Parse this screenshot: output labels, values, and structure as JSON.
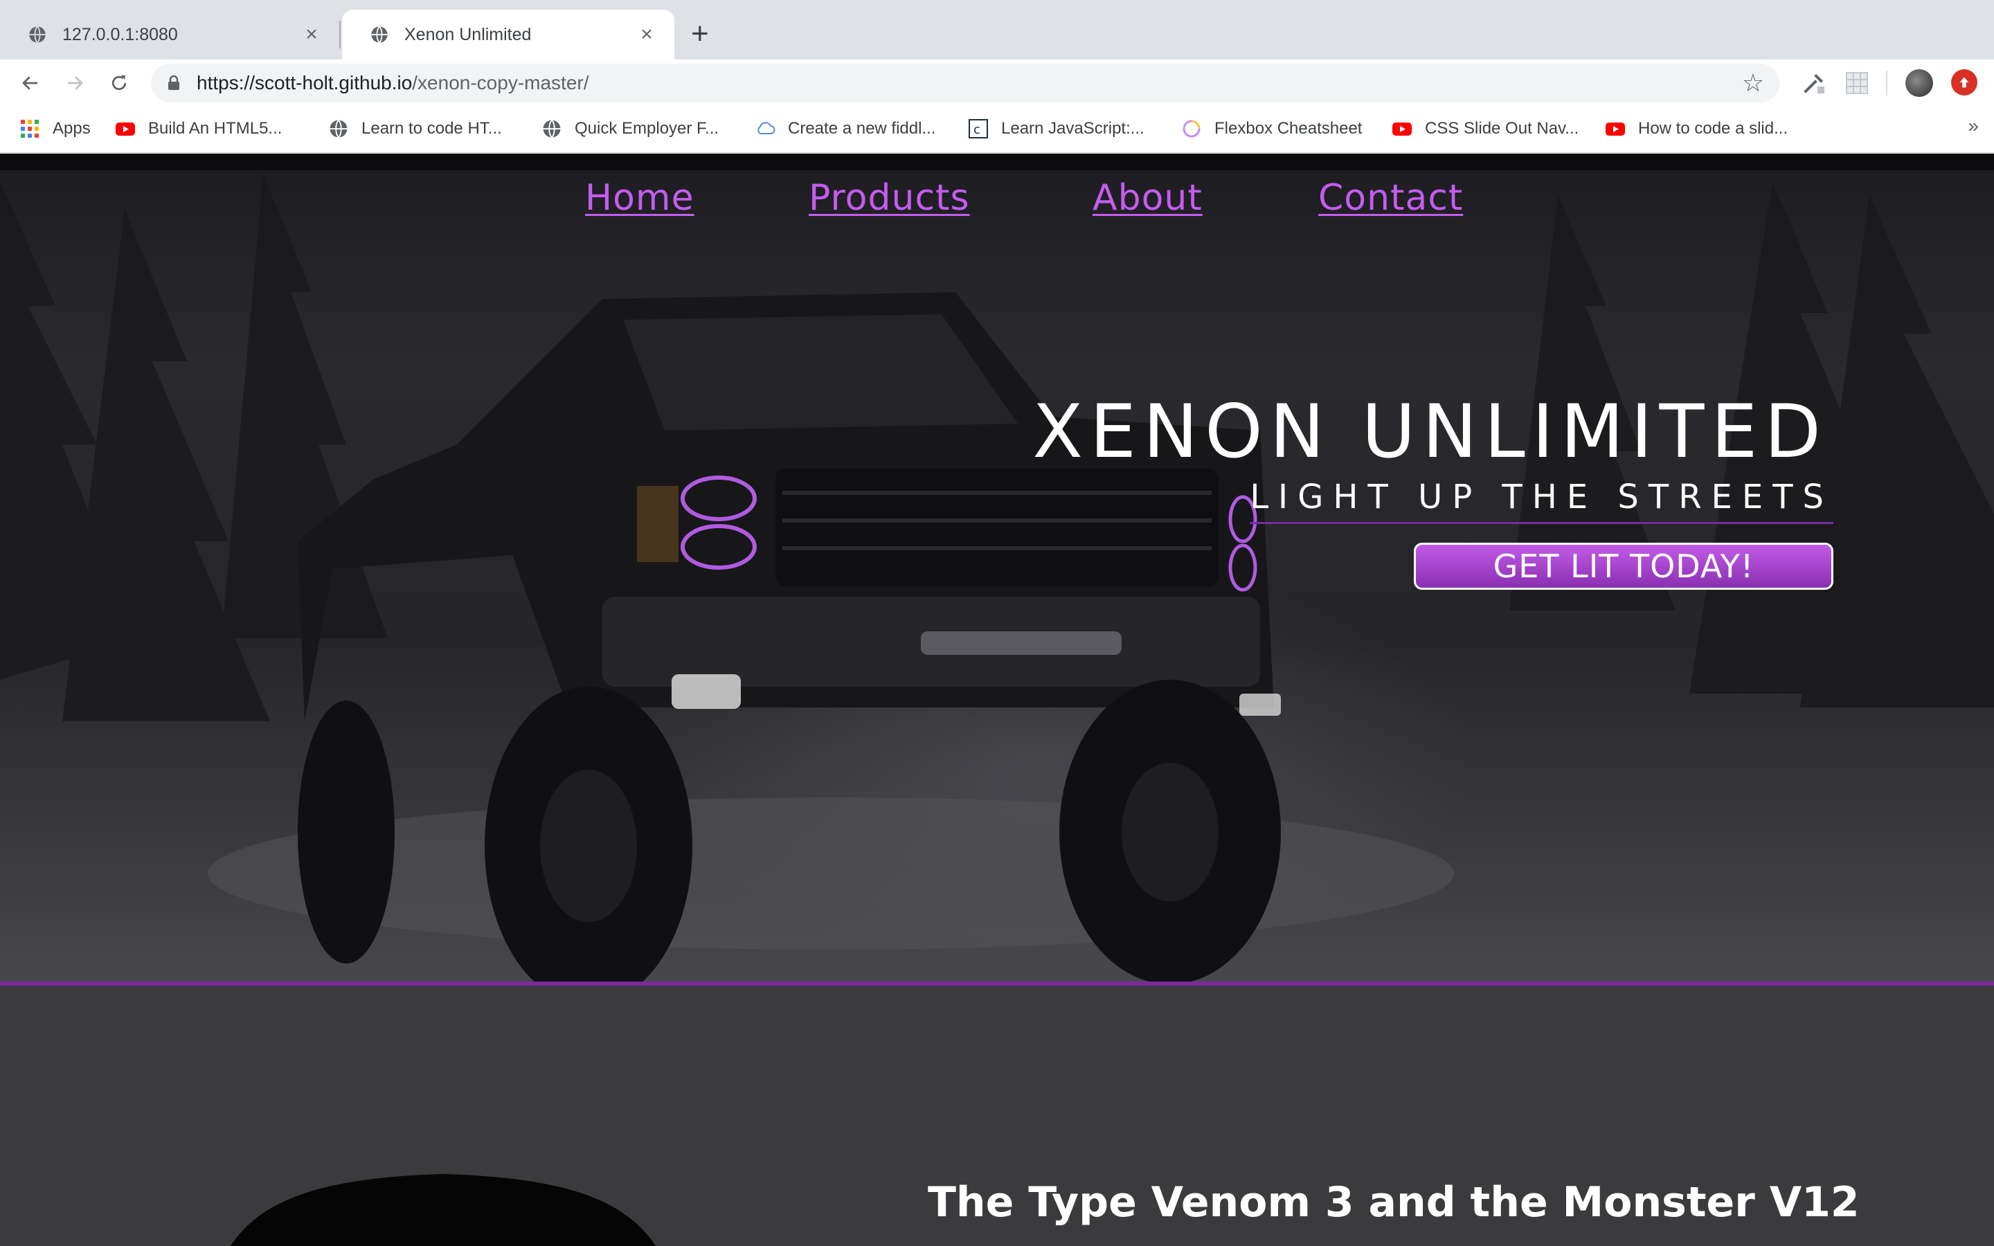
{
  "browser": {
    "tabs": [
      {
        "title": "127.0.0.1:8080",
        "active": false
      },
      {
        "title": "Xenon Unlimited",
        "active": true
      }
    ],
    "url": {
      "host": "https://scott-holt.github.io",
      "path": "/xenon-copy-master/"
    },
    "bookmarks": [
      {
        "label": "Apps",
        "icon": "apps-grid-icon"
      },
      {
        "label": "Build An HTML5...",
        "icon": "youtube-icon"
      },
      {
        "label": "Learn to code HT...",
        "icon": "globe-icon"
      },
      {
        "label": "Quick Employer F...",
        "icon": "globe-icon"
      },
      {
        "label": "Create a new fiddl...",
        "icon": "cloud-icon"
      },
      {
        "label": "Learn JavaScript:...",
        "icon": "codecademy-icon"
      },
      {
        "label": "Flexbox Cheatsheet",
        "icon": "ring-icon"
      },
      {
        "label": "CSS Slide Out Nav...",
        "icon": "youtube-icon"
      },
      {
        "label": "How to code a slid...",
        "icon": "youtube-icon"
      }
    ],
    "more_bookmarks": "»"
  },
  "site": {
    "nav": [
      "Home",
      "Products",
      "About",
      "Contact"
    ],
    "hero_title": "XENON UNLIMITED",
    "hero_subtitle": "LIGHT UP THE STREETS",
    "cta": "GET LIT TODAY!",
    "section_title": "The Type Venom 3 and the Monster V12"
  },
  "colors": {
    "accent": "#c55cf0",
    "accent_dark": "#7b2a9e",
    "page_bg": "#3b3b3d"
  }
}
